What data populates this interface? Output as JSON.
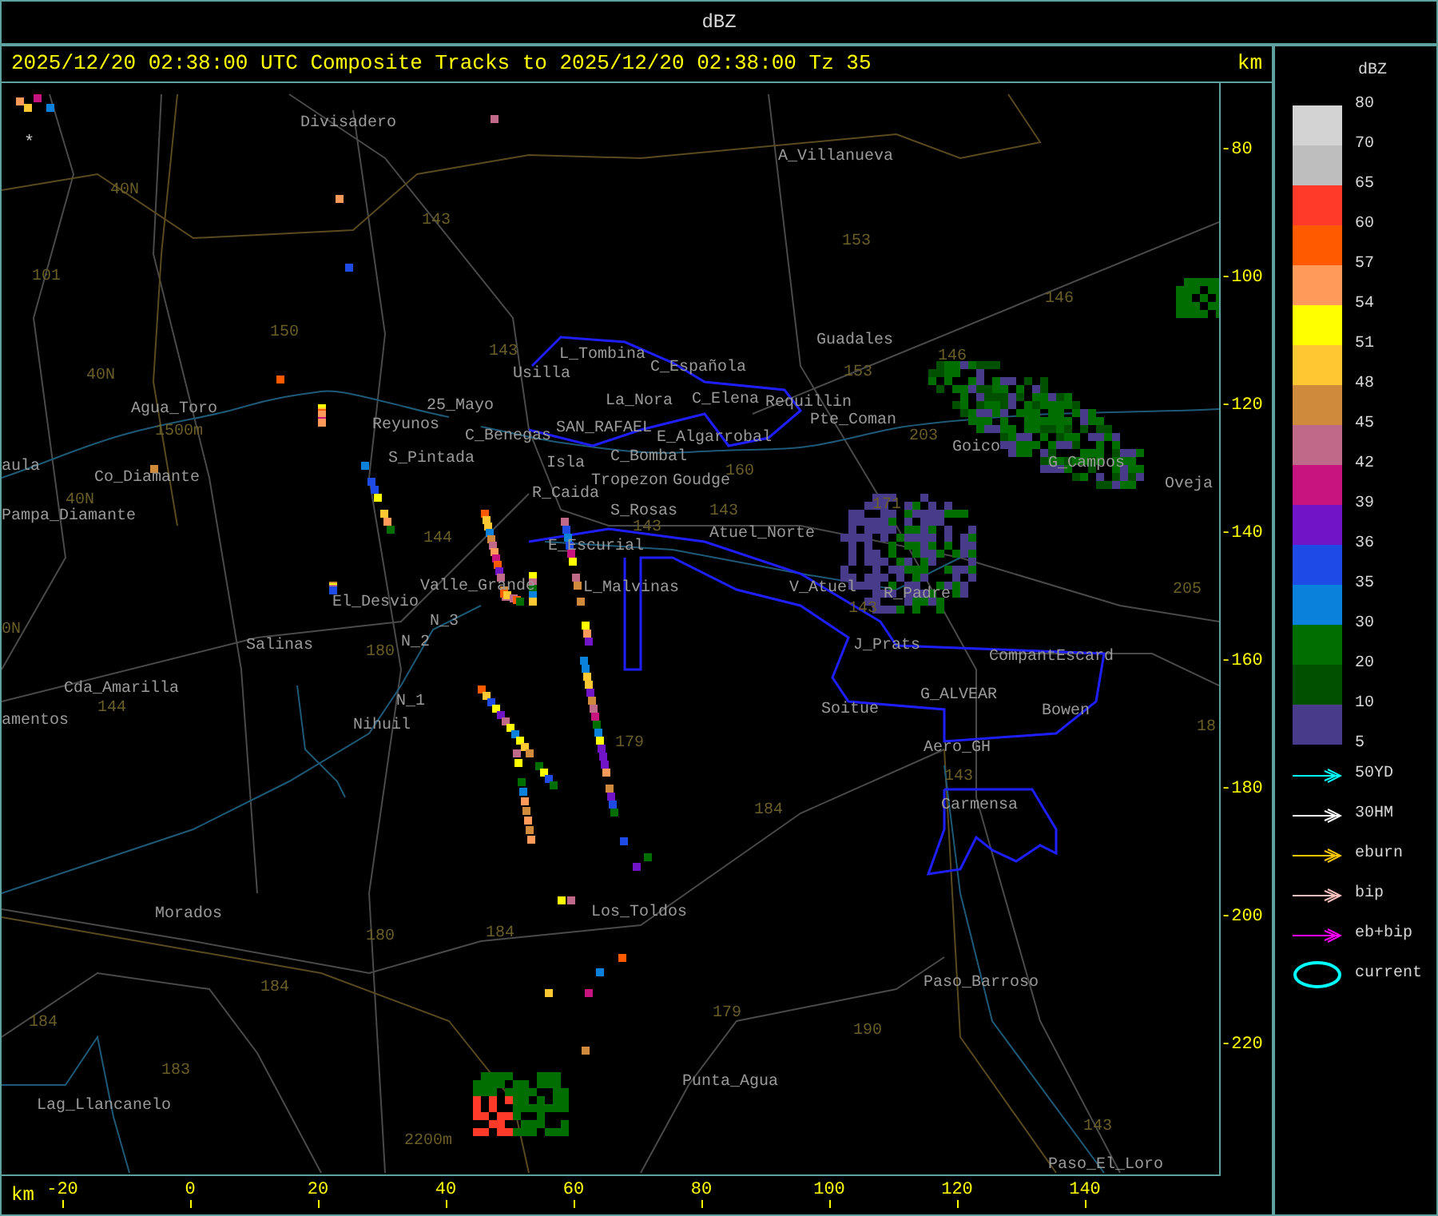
{
  "window": {
    "title": "dBZ"
  },
  "header": {
    "title": "2025/12/20 02:38:00 UTC Composite Tracks to 2025/12/20 02:38:00 Tz 35",
    "unit": "km"
  },
  "map": {
    "marker": "*",
    "places": [
      "Divisadero",
      "A_Villanueva",
      "Guadales",
      "L_Tombina",
      "Usilla",
      "C_Española",
      "La_Nora",
      "C_Elena",
      "Requillin",
      "Pte_Coman",
      "Goico",
      "G_Campos",
      "Oveja",
      "Agua_Toro",
      "aula",
      "Co_Diamante",
      "Pampa_Diamante",
      "Reyunos",
      "25_Mayo",
      "S_Pintada",
      "C_Benegas",
      "SAN_RAFAEL",
      "E_Algarrobal",
      "C_Bombal",
      "Isla",
      "R_Caida",
      "Tropezon",
      "Goudge",
      "S_Rosas",
      "E_Escurial",
      "Atuel_Norte",
      "Valle_Grande",
      "L_Malvinas",
      "V_Atuel",
      "R_Padre",
      "El_Desvio",
      "N_3",
      "Salinas",
      "N_2",
      "J_Prats",
      "CompantEscard",
      "Cda_Amarilla",
      "N_1",
      "Nihuil",
      "amentos",
      "G_ALVEAR",
      "Soitue",
      "Bowen",
      "Aero_GH",
      "Carmensa",
      "Morados",
      "Los_Toldos",
      "Paso_Barroso",
      "Punta_Agua",
      "Lag_Llancanelo",
      "Paso_El_Loro"
    ],
    "road_labels": [
      "40N",
      "101",
      "143",
      "150",
      "143",
      "40N",
      "1500m",
      "40N",
      "144",
      "153",
      "146",
      "153",
      "146",
      "203",
      "160",
      "171",
      "143",
      "143",
      "143",
      "0N",
      "180",
      "144",
      "205",
      "179",
      "18",
      "143",
      "184",
      "180",
      "184",
      "184",
      "184",
      "183",
      "179",
      "190",
      "143",
      "2200m"
    ]
  },
  "y_axis": {
    "ticks": [
      "-80",
      "-100",
      "-120",
      "-140",
      "-160",
      "-180",
      "-200",
      "-220"
    ]
  },
  "x_axis": {
    "unit": "km",
    "ticks": [
      "-20",
      "0",
      "20",
      "40",
      "60",
      "80",
      "100",
      "120",
      "140"
    ]
  },
  "legend": {
    "title": "dBZ",
    "bins": [
      {
        "color": "#d3d3d3"
      },
      {
        "color": "#bebebe"
      },
      {
        "color": "#ff3a28"
      },
      {
        "color": "#ff5a00"
      },
      {
        "color": "#ff9a5a"
      },
      {
        "color": "#ffff00"
      },
      {
        "color": "#ffc832"
      },
      {
        "color": "#d08a3c"
      },
      {
        "color": "#c06a8a"
      },
      {
        "color": "#c8147f"
      },
      {
        "color": "#7014c8"
      },
      {
        "color": "#1e4ae6"
      },
      {
        "color": "#0a82dc"
      },
      {
        "color": "#006e00"
      },
      {
        "color": "#005000"
      },
      {
        "color": "#483c8a"
      }
    ],
    "labels": [
      "80",
      "70",
      "65",
      "60",
      "57",
      "54",
      "51",
      "48",
      "45",
      "42",
      "39",
      "36",
      "35",
      "30",
      "20",
      "10",
      "5"
    ],
    "tracks": [
      {
        "kind": "arrow",
        "label": "50YD",
        "color": "#00ffff"
      },
      {
        "kind": "arrow",
        "label": "30HM",
        "color": "#ffffff"
      },
      {
        "kind": "arrow",
        "label": "eburn",
        "color": "#ffc800"
      },
      {
        "kind": "arrow",
        "label": "bip",
        "color": "#ffc0c0"
      },
      {
        "kind": "arrow",
        "label": "eb+bip",
        "color": "#ff00ff"
      },
      {
        "kind": "ellipse",
        "label": "current",
        "color": "#00ffff"
      }
    ]
  }
}
